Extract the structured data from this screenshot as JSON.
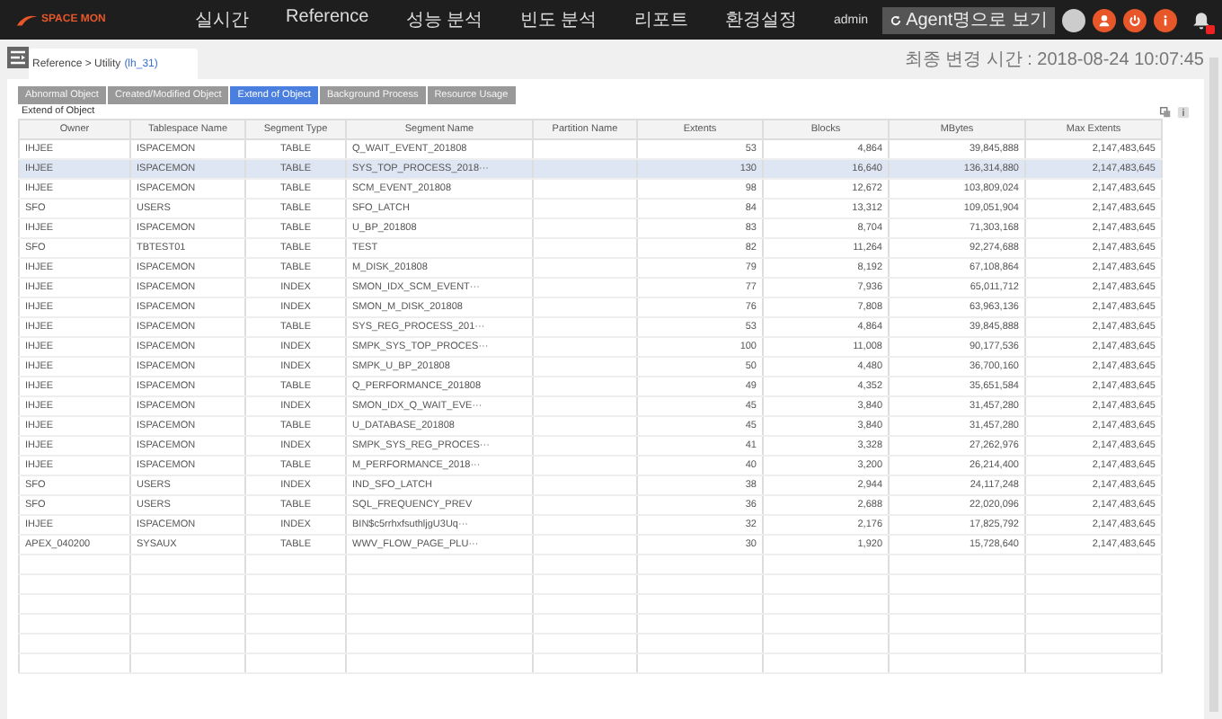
{
  "header": {
    "logo": "SPACE MON",
    "menu": [
      "실시간",
      "Reference",
      "성능 분석",
      "빈도 분석",
      "리포트",
      "환경설정"
    ],
    "user": "admin",
    "agent_button": "Agent명으로 보기",
    "notification_badge": true
  },
  "breadcrumb": {
    "path": "Reference > Utility",
    "instance": "(lh_31)"
  },
  "last_updated": "최종 변경 시간 : 2018-08-24 10:07:45",
  "tabs": [
    {
      "label": "Abnormal Object",
      "selected": false
    },
    {
      "label": "Created/Modified Object",
      "selected": false
    },
    {
      "label": "Extend of Object",
      "selected": true
    },
    {
      "label": "Background Process",
      "selected": false
    },
    {
      "label": "Resource Usage",
      "selected": false
    }
  ],
  "section_title": "Extend of Object",
  "table": {
    "columns": [
      "Owner",
      "Tablespace Name",
      "Segment Type",
      "Segment Name",
      "Partition Name",
      "Extents",
      "Blocks",
      "MBytes",
      "Max Extents"
    ],
    "rows": [
      {
        "cells": [
          "IHJEE",
          "ISPACEMON",
          "TABLE",
          "Q_WAIT_EVENT_201808",
          "",
          "53",
          "4,864",
          "39,845,888",
          "2,147,483,645"
        ],
        "selected": false
      },
      {
        "cells": [
          "IHJEE",
          "ISPACEMON",
          "TABLE",
          "SYS_TOP_PROCESS_2018···",
          "",
          "130",
          "16,640",
          "136,314,880",
          "2,147,483,645"
        ],
        "selected": true
      },
      {
        "cells": [
          "IHJEE",
          "ISPACEMON",
          "TABLE",
          "SCM_EVENT_201808",
          "",
          "98",
          "12,672",
          "103,809,024",
          "2,147,483,645"
        ],
        "selected": false
      },
      {
        "cells": [
          "SFO",
          "USERS",
          "TABLE",
          "SFO_LATCH",
          "",
          "84",
          "13,312",
          "109,051,904",
          "2,147,483,645"
        ],
        "selected": false
      },
      {
        "cells": [
          "IHJEE",
          "ISPACEMON",
          "TABLE",
          "U_BP_201808",
          "",
          "83",
          "8,704",
          "71,303,168",
          "2,147,483,645"
        ],
        "selected": false
      },
      {
        "cells": [
          "SFO",
          "TBTEST01",
          "TABLE",
          "TEST",
          "",
          "82",
          "11,264",
          "92,274,688",
          "2,147,483,645"
        ],
        "selected": false
      },
      {
        "cells": [
          "IHJEE",
          "ISPACEMON",
          "TABLE",
          "M_DISK_201808",
          "",
          "79",
          "8,192",
          "67,108,864",
          "2,147,483,645"
        ],
        "selected": false
      },
      {
        "cells": [
          "IHJEE",
          "ISPACEMON",
          "INDEX",
          "SMON_IDX_SCM_EVENT···",
          "",
          "77",
          "7,936",
          "65,011,712",
          "2,147,483,645"
        ],
        "selected": false
      },
      {
        "cells": [
          "IHJEE",
          "ISPACEMON",
          "INDEX",
          "SMON_M_DISK_201808",
          "",
          "76",
          "7,808",
          "63,963,136",
          "2,147,483,645"
        ],
        "selected": false
      },
      {
        "cells": [
          "IHJEE",
          "ISPACEMON",
          "TABLE",
          "SYS_REG_PROCESS_201···",
          "",
          "53",
          "4,864",
          "39,845,888",
          "2,147,483,645"
        ],
        "selected": false
      },
      {
        "cells": [
          "IHJEE",
          "ISPACEMON",
          "INDEX",
          "SMPK_SYS_TOP_PROCES···",
          "",
          "100",
          "11,008",
          "90,177,536",
          "2,147,483,645"
        ],
        "selected": false
      },
      {
        "cells": [
          "IHJEE",
          "ISPACEMON",
          "INDEX",
          "SMPK_U_BP_201808",
          "",
          "50",
          "4,480",
          "36,700,160",
          "2,147,483,645"
        ],
        "selected": false
      },
      {
        "cells": [
          "IHJEE",
          "ISPACEMON",
          "TABLE",
          "Q_PERFORMANCE_201808",
          "",
          "49",
          "4,352",
          "35,651,584",
          "2,147,483,645"
        ],
        "selected": false
      },
      {
        "cells": [
          "IHJEE",
          "ISPACEMON",
          "INDEX",
          "SMON_IDX_Q_WAIT_EVE···",
          "",
          "45",
          "3,840",
          "31,457,280",
          "2,147,483,645"
        ],
        "selected": false
      },
      {
        "cells": [
          "IHJEE",
          "ISPACEMON",
          "TABLE",
          "U_DATABASE_201808",
          "",
          "45",
          "3,840",
          "31,457,280",
          "2,147,483,645"
        ],
        "selected": false
      },
      {
        "cells": [
          "IHJEE",
          "ISPACEMON",
          "INDEX",
          "SMPK_SYS_REG_PROCES···",
          "",
          "41",
          "3,328",
          "27,262,976",
          "2,147,483,645"
        ],
        "selected": false
      },
      {
        "cells": [
          "IHJEE",
          "ISPACEMON",
          "TABLE",
          "M_PERFORMANCE_2018···",
          "",
          "40",
          "3,200",
          "26,214,400",
          "2,147,483,645"
        ],
        "selected": false
      },
      {
        "cells": [
          "SFO",
          "USERS",
          "INDEX",
          "IND_SFO_LATCH",
          "",
          "38",
          "2,944",
          "24,117,248",
          "2,147,483,645"
        ],
        "selected": false
      },
      {
        "cells": [
          "SFO",
          "USERS",
          "TABLE",
          "SQL_FREQUENCY_PREV",
          "",
          "36",
          "2,688",
          "22,020,096",
          "2,147,483,645"
        ],
        "selected": false
      },
      {
        "cells": [
          "IHJEE",
          "ISPACEMON",
          "INDEX",
          "BIN$c5rrhxfsuthljgU3Uq···",
          "",
          "32",
          "2,176",
          "17,825,792",
          "2,147,483,645"
        ],
        "selected": false
      },
      {
        "cells": [
          "APEX_040200",
          "SYSAUX",
          "TABLE",
          "WWV_FLOW_PAGE_PLU···",
          "",
          "30",
          "1,920",
          "15,728,640",
          "2,147,483,645"
        ],
        "selected": false
      }
    ]
  }
}
